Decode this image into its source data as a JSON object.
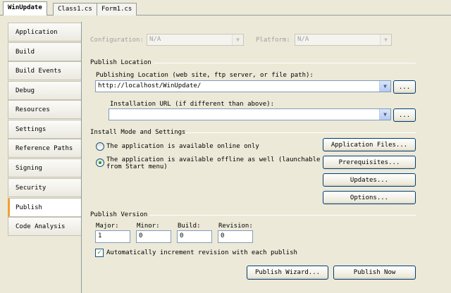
{
  "doc_tabs": [
    "WinUpdate",
    "Class1.cs",
    "Form1.cs"
  ],
  "side_tabs": [
    "Application",
    "Build",
    "Build Events",
    "Debug",
    "Resources",
    "Settings",
    "Reference Paths",
    "Signing",
    "Security",
    "Publish",
    "Code Analysis"
  ],
  "active_side_tab": "Publish",
  "top": {
    "configuration_label": "Configuration:",
    "configuration_value": "N/A",
    "platform_label": "Platform:",
    "platform_value": "N/A"
  },
  "publish_location": {
    "title": "Publish Location",
    "publishing_label": "Publishing Location (web site, ftp server, or file path):",
    "publishing_value": "http://localhost/WinUpdate/",
    "install_url_label": "Installation URL (if different than above):",
    "install_url_value": "",
    "browse_label": "..."
  },
  "install_mode": {
    "title": "Install Mode and Settings",
    "online_only": "The application is available online only",
    "offline_line1": "The application is available offline as well (launchable",
    "offline_line2": "from Start menu)",
    "selected": "offline",
    "buttons": {
      "application_files": "Application Files...",
      "prerequisites": "Prerequisites...",
      "updates": "Updates...",
      "options": "Options..."
    }
  },
  "publish_version": {
    "title": "Publish Version",
    "major_label": "Major:",
    "minor_label": "Minor:",
    "build_label": "Build:",
    "revision_label": "Revision:",
    "major": "1",
    "minor": "0",
    "build": "0",
    "revision": "0",
    "auto_increment_label": "Automatically increment revision with each publish",
    "auto_increment_checked": true
  },
  "actions": {
    "publish_wizard": "Publish Wizard...",
    "publish_now": "Publish Now"
  }
}
